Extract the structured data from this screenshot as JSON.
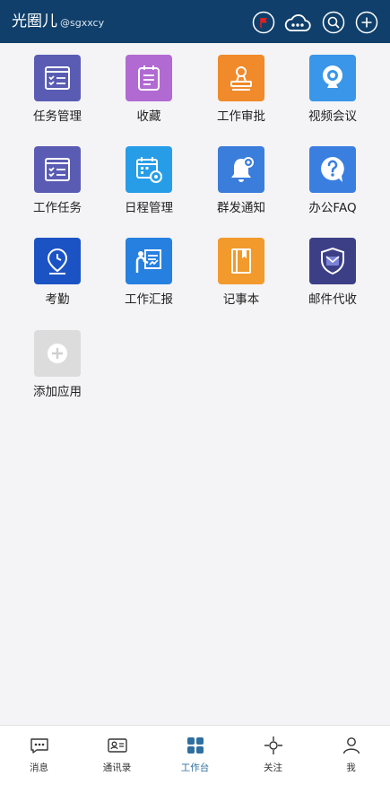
{
  "header": {
    "title": "光圈儿",
    "handle": "@sgxxcy"
  },
  "apps": [
    {
      "label": "任务管理",
      "icon": "task-list-icon",
      "color": "#5a5cb4"
    },
    {
      "label": "收藏",
      "icon": "notepad-icon",
      "color": "#b16ad2"
    },
    {
      "label": "工作审批",
      "icon": "stamp-icon",
      "color": "#f08a2a"
    },
    {
      "label": "视频会议",
      "icon": "webcam-icon",
      "color": "#3a96e8"
    },
    {
      "label": "工作任务",
      "icon": "task-list-icon",
      "color": "#5a5cb4"
    },
    {
      "label": "日程管理",
      "icon": "calendar-gear-icon",
      "color": "#279de8"
    },
    {
      "label": "群发通知",
      "icon": "bell-icon",
      "color": "#3b7ddb"
    },
    {
      "label": "办公FAQ",
      "icon": "question-bubble-icon",
      "color": "#3a7fe0"
    },
    {
      "label": "考勤",
      "icon": "location-clock-icon",
      "color": "#1b53c4"
    },
    {
      "label": "工作汇报",
      "icon": "presentation-icon",
      "color": "#2680e0"
    },
    {
      "label": "记事本",
      "icon": "notebook-icon",
      "color": "#f29a2c"
    },
    {
      "label": "邮件代收",
      "icon": "mail-shield-icon",
      "color": "#3c3f86"
    },
    {
      "label": "添加应用",
      "icon": "add-icon",
      "color": "#dcdcdc"
    }
  ],
  "tabs": [
    {
      "label": "消息",
      "icon": "chat-bubble-icon"
    },
    {
      "label": "通讯录",
      "icon": "contact-card-icon"
    },
    {
      "label": "工作台",
      "icon": "grid-icon",
      "active": true
    },
    {
      "label": "关注",
      "icon": "crosshair-icon"
    },
    {
      "label": "我",
      "icon": "person-icon"
    }
  ],
  "colors": {
    "header": "#0f3f6a",
    "active_tab": "#2f6f9f",
    "badge": "#e02020"
  }
}
